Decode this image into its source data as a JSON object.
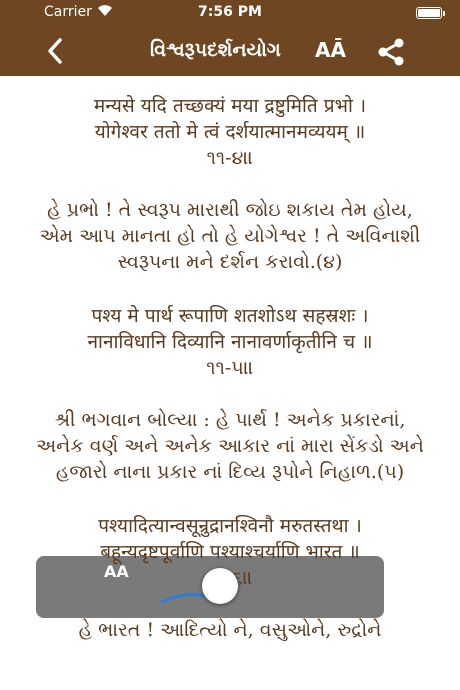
{
  "status_bar": {
    "carrier": "Carrier",
    "time": "7:56 PM",
    "wifi_icon": "wifi-icon",
    "battery_level": 1.0
  },
  "nav": {
    "title": "વિશ્વરૂપદર્શનયોગ",
    "font_size_label": "AĀ",
    "back_icon": "chevron-left-icon",
    "share_icon": "share-icon"
  },
  "verses": [
    {
      "sanskrit_1": "मन्यसे यदि तच्छक्यं मया द्रष्टुमिति प्रभो ।",
      "sanskrit_2": "योगेश्वर ततो मे त्वं दर्शयात्मानमव्ययम् ॥",
      "number": "૧૧-૪॥",
      "translation": "હે પ્રભો ! તે સ્વરૂપ મારાથી જોઇ શકાય તેમ હોય, એમ આપ માનતા હો તો હે યોગેશ્વર ! તે અવિનાશી સ્વરૂપના મને દર્શન કરાવો.(૪)"
    },
    {
      "sanskrit_1": "पश्य मे पार्थ रूपाणि शतशोऽथ सहस्रशः ।",
      "sanskrit_2": "नानाविधानि दिव्यानि नानावर्णाकृतीनि च ॥",
      "number": "૧૧-૫॥",
      "translation": "શ્રી ભગવાન બોલ્યા : હે પાર્થ ! અનેક પ્રકારનાં, અનેક વર્ણ અને અનેક આકાર નાં મારા સેંકડો અને હજારો નાના પ્રકાર નાં દિવ્ય રૂપોને નિહાળ.(૫)"
    },
    {
      "sanskrit_1": "पश्यादित्यान्वसून्रुद्रानश्विनौ मरुतस्तथा ।",
      "sanskrit_2": "बहून्यदृष्टपूर्वाणि पश्याश्चर्याणि भारत ॥",
      "number": "૧૧-૬॥",
      "translation": "હે ભારત ! આદિત્યો ને, વસુઓને, રુદ્રોને"
    }
  ],
  "overlay": {
    "zoom_label": "AA"
  }
}
